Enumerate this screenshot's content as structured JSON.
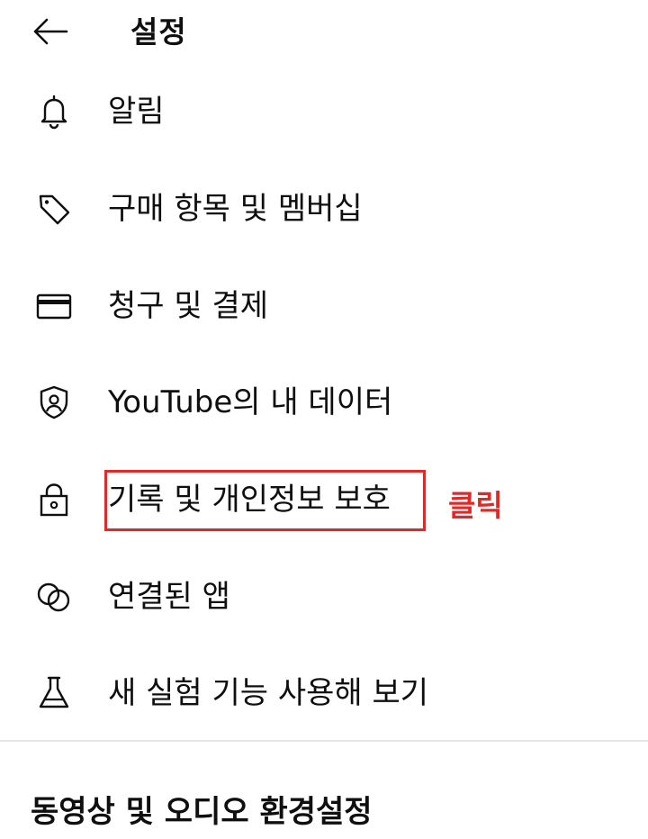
{
  "header": {
    "title": "설정",
    "back_icon": "arrow-left-icon"
  },
  "menu": {
    "items": [
      {
        "label": "알림",
        "icon": "bell-icon"
      },
      {
        "label": "구매 항목 및 멤버십",
        "icon": "tag-icon"
      },
      {
        "label": "청구 및 결제",
        "icon": "credit-card-icon"
      },
      {
        "label": "YouTube의 내 데이터",
        "icon": "shield-person-icon"
      },
      {
        "label": "기록 및 개인정보 보호",
        "icon": "lock-icon"
      },
      {
        "label": "연결된 앱",
        "icon": "linked-circles-icon"
      },
      {
        "label": "새 실험 기능 사용해 보기",
        "icon": "flask-icon"
      }
    ]
  },
  "annotation": {
    "text": "클릭",
    "color": "#e02a2a"
  },
  "section": {
    "title": "동영상 및 오디오 환경설정"
  }
}
